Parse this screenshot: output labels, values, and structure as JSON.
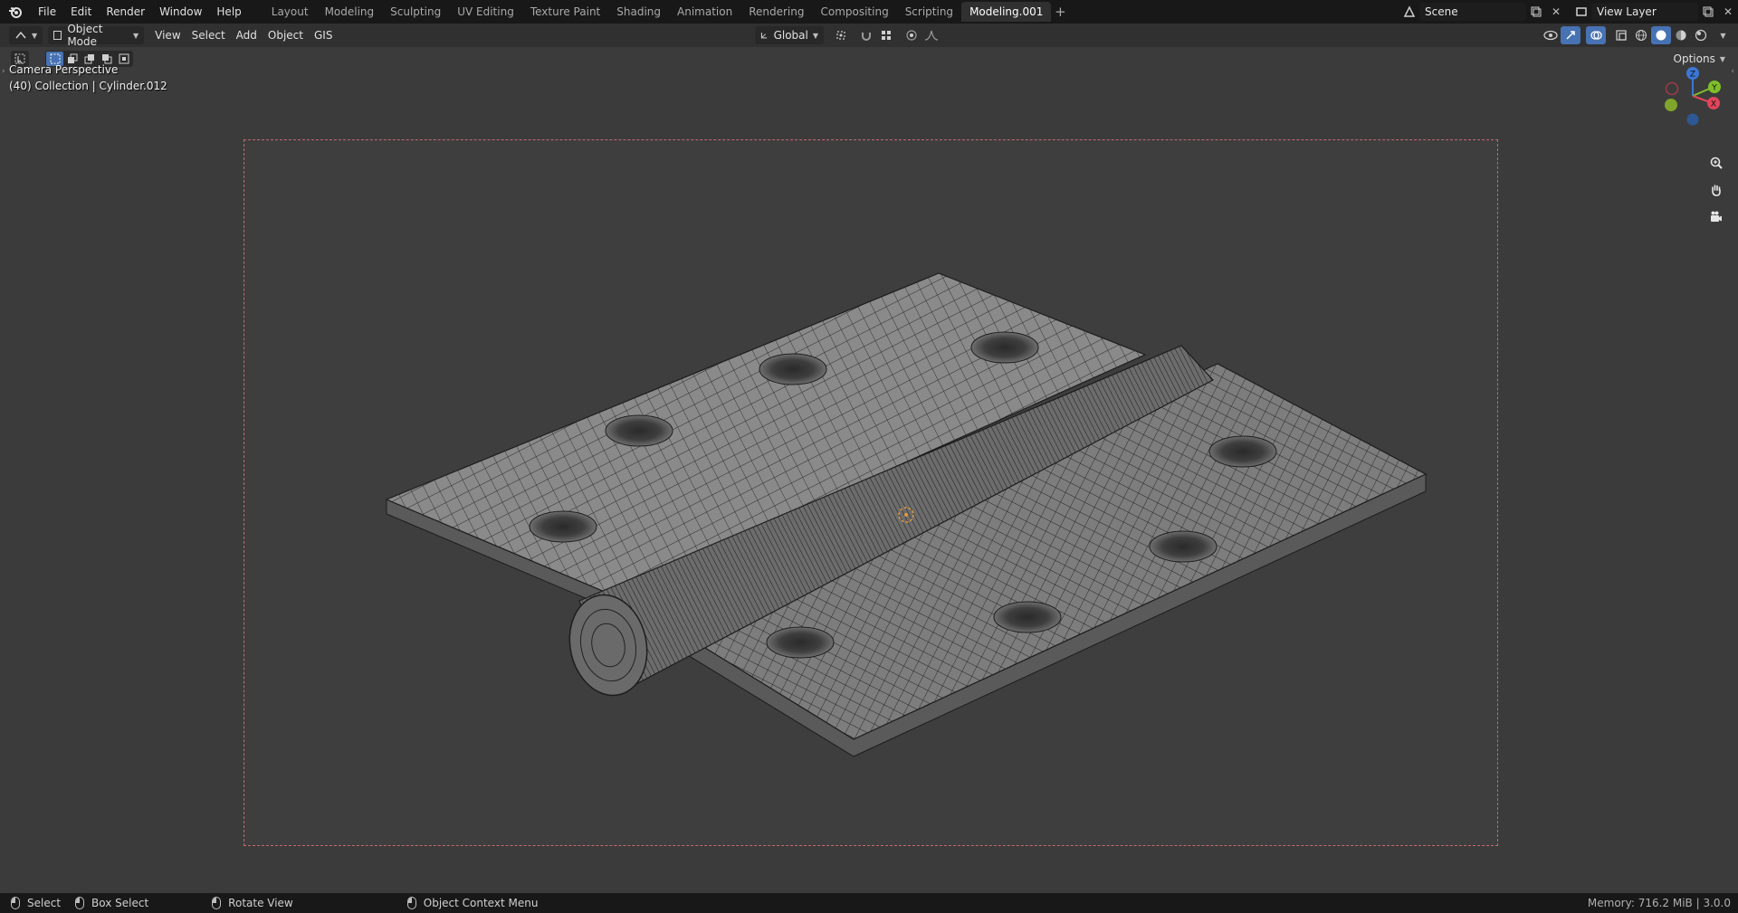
{
  "menu": {
    "file": "File",
    "edit": "Edit",
    "render": "Render",
    "window": "Window",
    "help": "Help"
  },
  "workspaces": [
    "Layout",
    "Modeling",
    "Sculpting",
    "UV Editing",
    "Texture Paint",
    "Shading",
    "Animation",
    "Rendering",
    "Compositing",
    "Scripting",
    "Modeling.001"
  ],
  "active_workspace": "Modeling.001",
  "add_workspace": "+",
  "scene_name": "Scene",
  "view_layer_name": "View Layer",
  "header": {
    "mode": "Object Mode",
    "view": "View",
    "select": "Select",
    "add": "Add",
    "object": "Object",
    "gis": "GIS",
    "orientation": "Global",
    "options": "Options"
  },
  "viewport": {
    "perspective_label": "Camera Perspective",
    "collection_label": "(40) Collection | Cylinder.012",
    "gizmo": {
      "z": "Z",
      "y": "Y",
      "x": "X"
    },
    "colors": {
      "bg": "#3b3b3b",
      "frame": "#c56a6a",
      "mesh": "#8a8a8a",
      "wire": "#1b1b1b"
    }
  },
  "status": {
    "select": "Select",
    "box_select": "Box Select",
    "rotate_view": "Rotate View",
    "context_menu": "Object Context Menu",
    "memory": "Memory: 716.2 MiB | 3.0.0"
  }
}
